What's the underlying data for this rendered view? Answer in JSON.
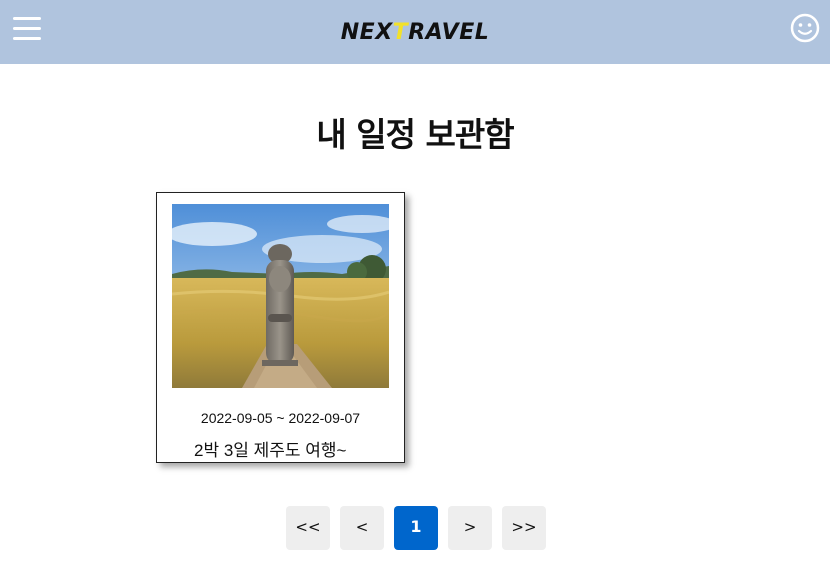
{
  "header": {
    "logo_prefix": "NEX",
    "logo_highlight": "T",
    "logo_suffix": "RAVEL",
    "menu_icon": "hamburger-menu-icon",
    "profile_icon": "smiley-face-icon",
    "background_color": "#b0c4de",
    "logo_highlight_color": "#f2e12a"
  },
  "page": {
    "title": "내 일정 보관함"
  },
  "schedules": [
    {
      "dates": "2022-09-05 ~ 2022-09-07",
      "name": "2박 3일 제주도 여행~",
      "image_subject": "dol-hareubang-statue-in-barley-field"
    }
  ],
  "pagination": {
    "first": "<<",
    "prev": "<",
    "pages": [
      "1"
    ],
    "current": "1",
    "next": ">",
    "last": ">>",
    "active_color": "#0066cc"
  }
}
